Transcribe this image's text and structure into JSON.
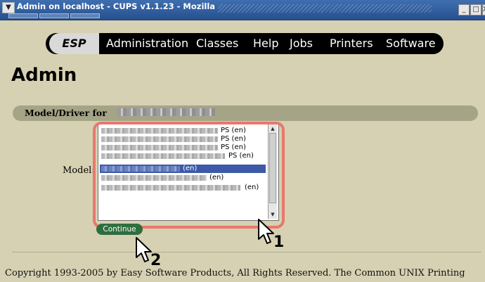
{
  "window": {
    "title": "Admin on localhost - CUPS v1.1.23 - Mozilla",
    "menu_icon": "chevron-down-icon",
    "buttons": {
      "minimize": "_",
      "maximize": "□",
      "close": "X"
    }
  },
  "nav": {
    "items": [
      "ESP",
      "Administration",
      "Classes",
      "Help",
      "Jobs",
      "Printers",
      "Software"
    ]
  },
  "page": {
    "title": "Admin",
    "model_driver_label": "Model/Driver for",
    "model_label": "Model:",
    "continue_label": "Continue",
    "copyright": "Copyright 1993-2005 by Easy Software Products, All Rights Reserved. The Common UNIX Printing"
  },
  "models": {
    "items": [
      {
        "suffix": "PS (en)",
        "selected": false
      },
      {
        "suffix": "PS (en)",
        "selected": false
      },
      {
        "suffix": "PS (en)",
        "selected": false
      },
      {
        "suffix": "PS (en)",
        "selected": false
      },
      {
        "suffix": "(en)",
        "selected": true
      },
      {
        "suffix": "(en)",
        "selected": false
      },
      {
        "suffix": "(en)",
        "selected": false
      }
    ]
  },
  "annotations": {
    "step1": "1",
    "step2": "2",
    "highlight_color": "#e9786c"
  },
  "colors": {
    "page_background": "#d6d1b2",
    "titlebar": "#26508f",
    "nav_background": "#000000",
    "section_bar": "#a6a486",
    "selected_row": "#3c5aa8",
    "continue_button": "#2f6e3d"
  }
}
